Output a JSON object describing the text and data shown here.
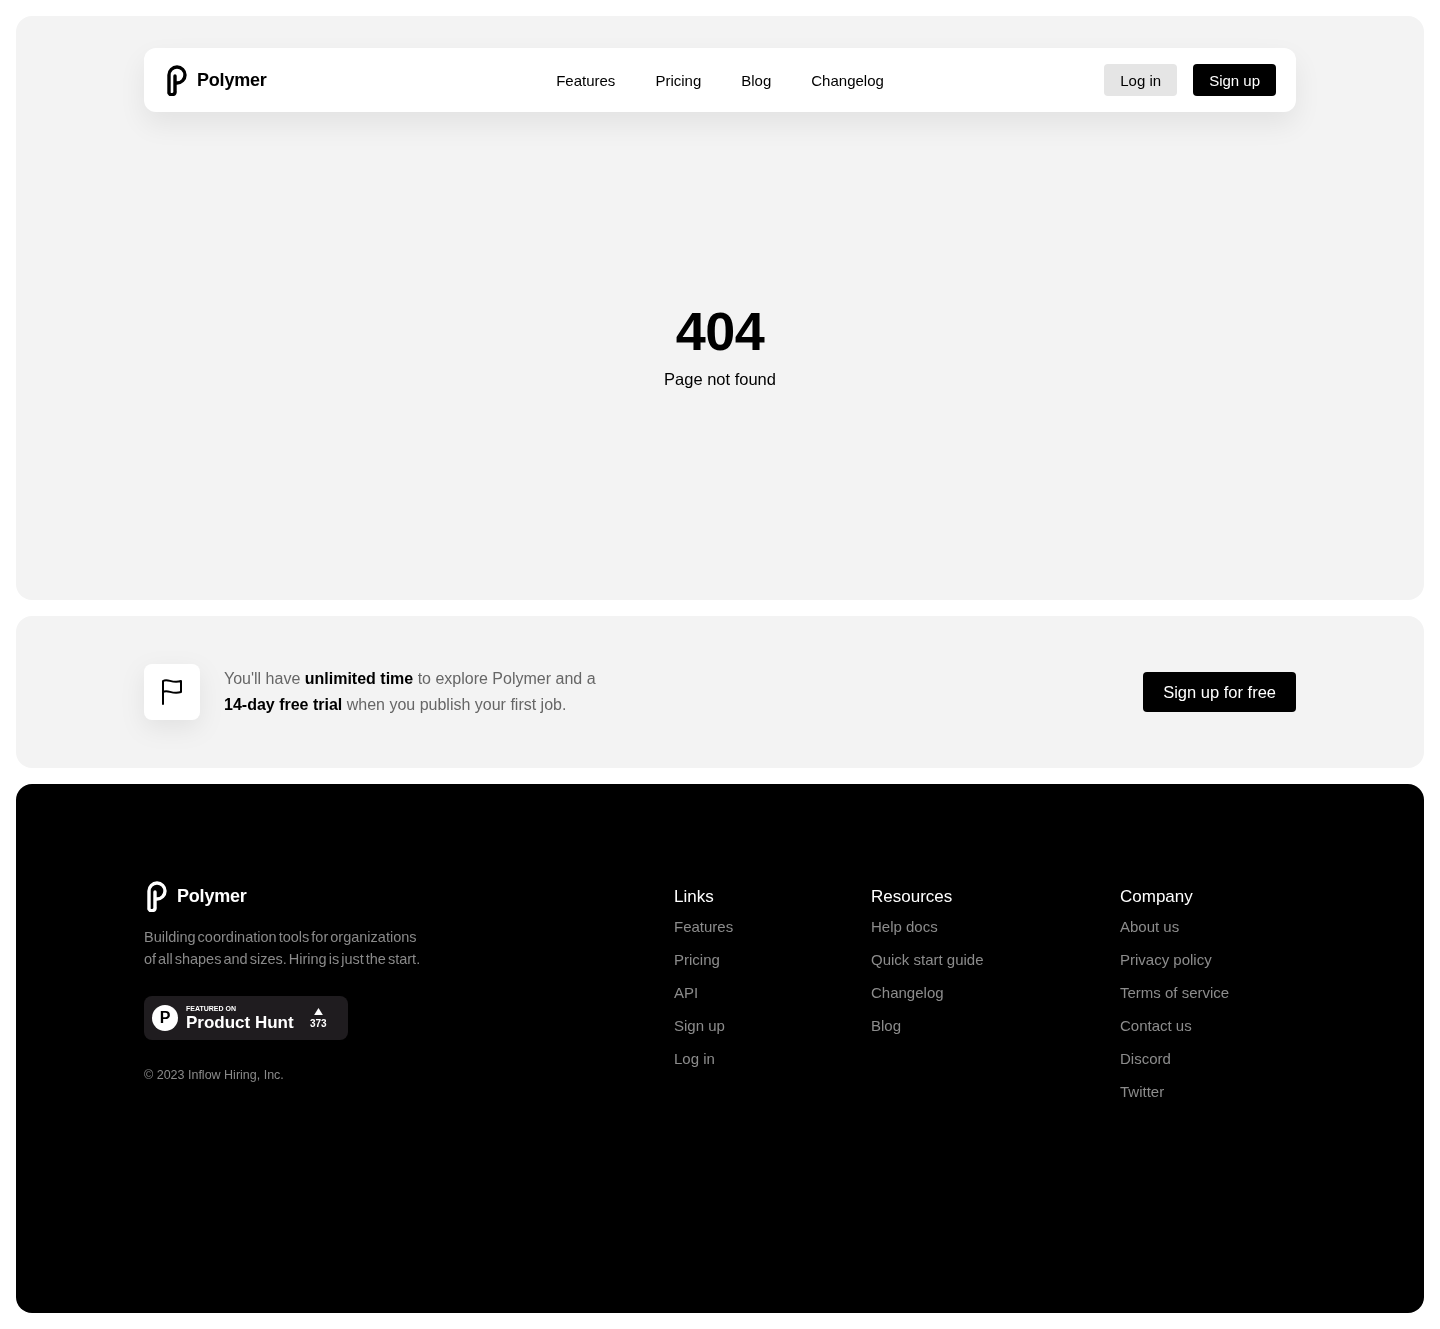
{
  "nav": {
    "logo": "Polymer",
    "links": [
      {
        "label": "Features"
      },
      {
        "label": "Pricing"
      },
      {
        "label": "Blog"
      },
      {
        "label": "Changelog"
      }
    ],
    "buttons": [
      {
        "label": "Log in",
        "kind": "secondary"
      },
      {
        "label": "Sign up",
        "kind": "primary"
      }
    ]
  },
  "error": {
    "code": "404",
    "message": "Page not found"
  },
  "cta": {
    "text": "You'll have **unlimited time** to explore Polymer and a **14-day free trial** when you publish your first job.",
    "button": "Sign up for free"
  },
  "footer": {
    "logo": "Polymer",
    "description": "Building coordination tools for organizations of all shapes and sizes. Hiring is just the start.",
    "badge": {
      "logo_mark": "P",
      "caption": "FEATURED ON",
      "name": "Product Hunt",
      "count": "373"
    },
    "copyright": "© 2023 Inflow Hiring, Inc.",
    "columns": [
      {
        "heading": "Links",
        "links": [
          "Features",
          "Pricing",
          "API",
          "Sign up",
          "Log in"
        ]
      },
      {
        "heading": "Resources",
        "links": [
          "Help docs",
          "Quick start guide",
          "Changelog",
          "Blog"
        ]
      },
      {
        "heading": "Company",
        "links": [
          "About us",
          "Privacy policy",
          "Terms of service",
          "Contact us",
          "Discord",
          "Twitter"
        ]
      }
    ]
  }
}
